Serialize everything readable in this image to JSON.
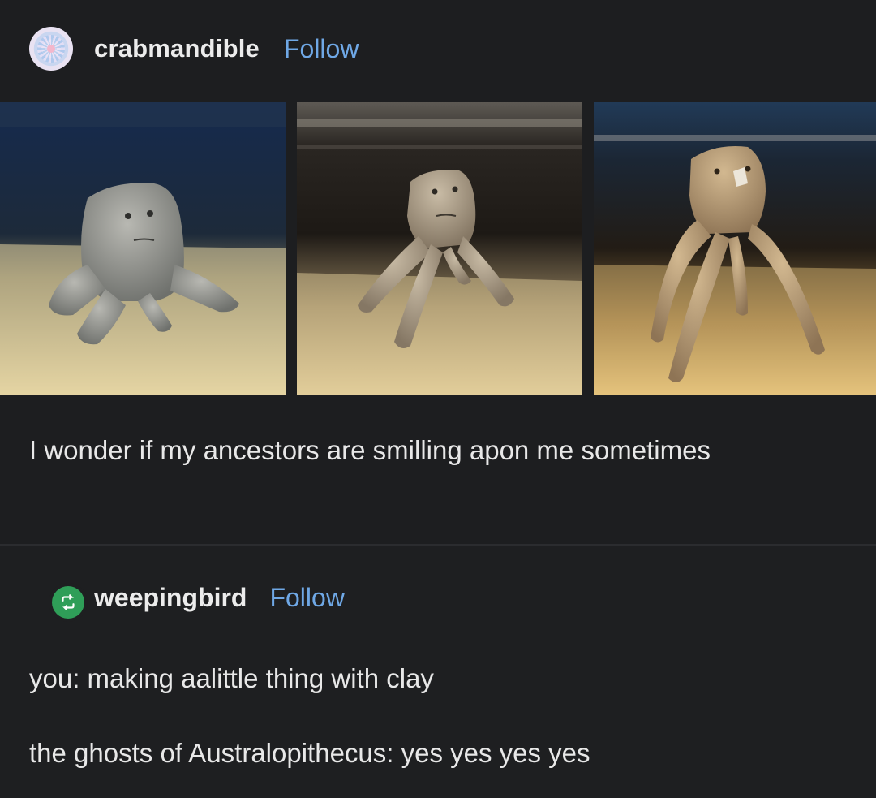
{
  "post": {
    "username": "crabmandible",
    "follow_label": "Follow",
    "avatar_icon": "flower-avatar-icon",
    "photos": [
      {
        "alt": "clay figure short legs"
      },
      {
        "alt": "clay figure medium legs"
      },
      {
        "alt": "clay figure long legs"
      }
    ],
    "caption": "I wonder if my ancestors are smilling apon me sometimes"
  },
  "reblog": {
    "username": "weepingbird",
    "follow_label": "Follow",
    "badge_icon": "reblog-icon",
    "badge_color": "#2f9e58",
    "lines": [
      "you: making aalittle thing with clay",
      "the ghosts of Australopithecus: yes yes yes yes"
    ]
  },
  "colors": {
    "background": "#1e1f21",
    "link": "#6fa8e6",
    "text": "#e8e8e8"
  }
}
